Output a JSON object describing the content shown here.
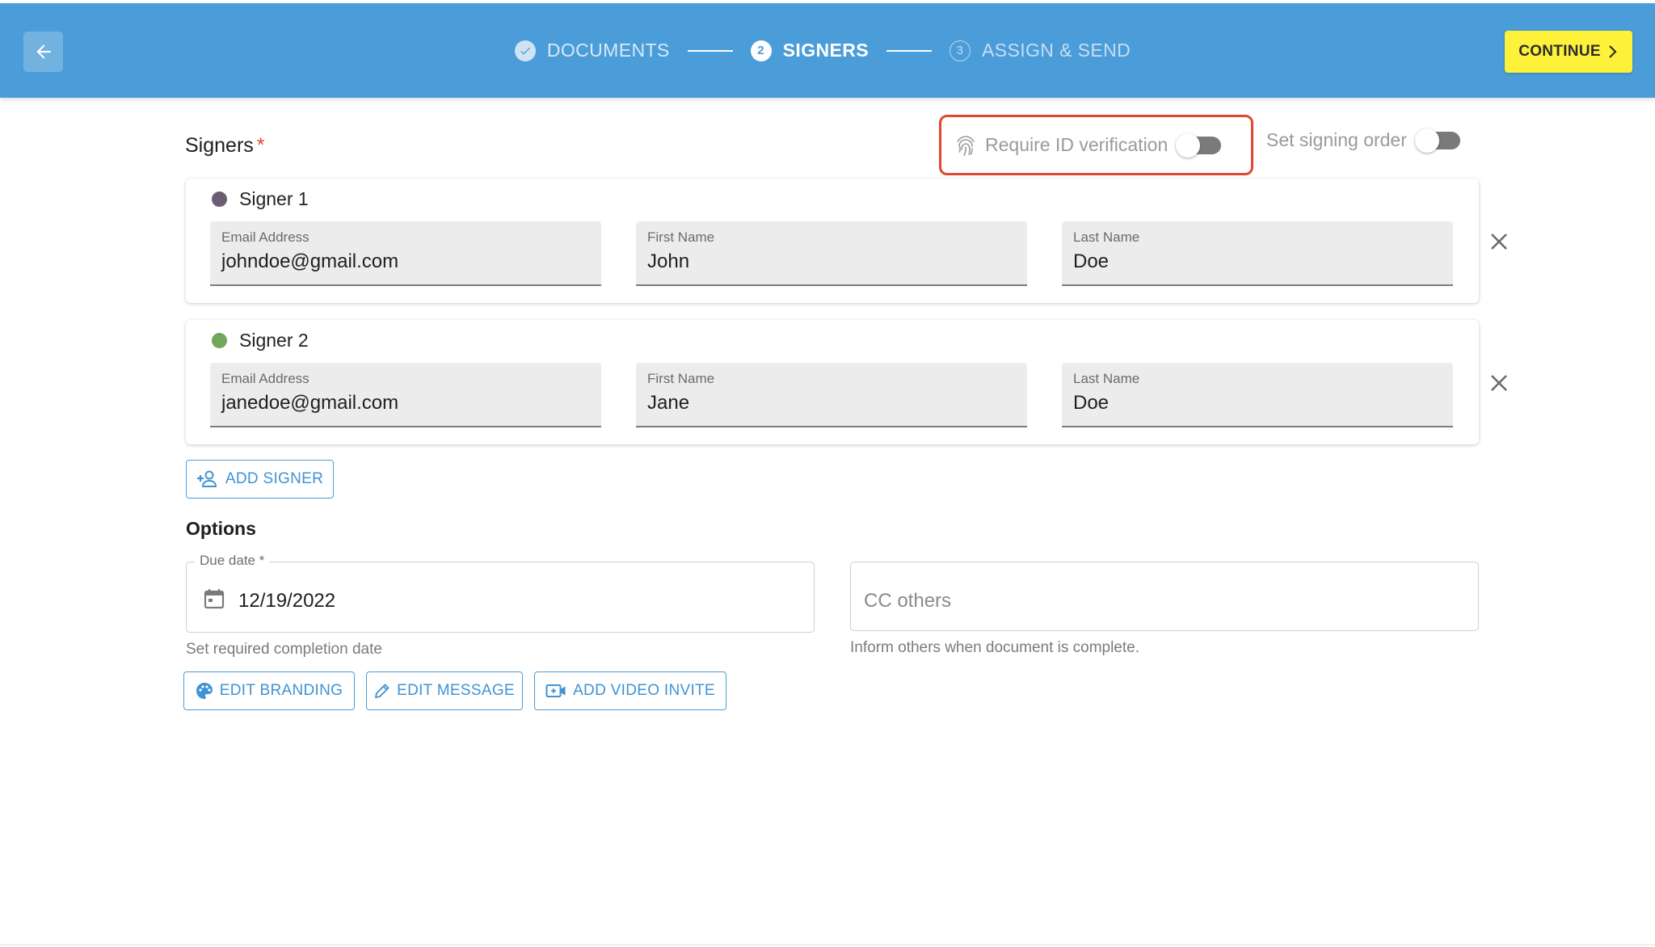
{
  "header": {
    "steps": [
      {
        "label": "DOCUMENTS",
        "badge": "",
        "state": "done"
      },
      {
        "label": "SIGNERS",
        "badge": "2",
        "state": "active"
      },
      {
        "label": "ASSIGN & SEND",
        "badge": "3",
        "state": "pending"
      }
    ],
    "continue_label": "CONTINUE"
  },
  "signers_section": {
    "title": "Signers",
    "required_mark": "*",
    "id_verification_label": "Require ID verification",
    "id_verification_on": false,
    "signing_order_label": "Set signing order",
    "signing_order_on": false
  },
  "signers": [
    {
      "name": "Signer 1",
      "color": "#6b5d72",
      "email_label": "Email Address",
      "email": "johndoe@gmail.com",
      "first_label": "First Name",
      "first": "John",
      "last_label": "Last Name",
      "last": "Doe"
    },
    {
      "name": "Signer 2",
      "color": "#72a659",
      "email_label": "Email Address",
      "email": "janedoe@gmail.com",
      "first_label": "First Name",
      "first": "Jane",
      "last_label": "Last Name",
      "last": "Doe"
    }
  ],
  "add_signer_label": "ADD SIGNER",
  "options": {
    "title": "Options",
    "due_date_label": "Due date *",
    "due_date_value": "12/19/2022",
    "due_date_help": "Set required completion date",
    "cc_placeholder": "CC others",
    "cc_help": "Inform others when document is complete."
  },
  "actions": {
    "edit_branding": "EDIT BRANDING",
    "edit_message": "EDIT MESSAGE",
    "add_video_invite": "ADD VIDEO INVITE"
  },
  "colors": {
    "header": "#4a9dd9",
    "continue": "#fef13a",
    "highlight": "#e1472d",
    "accent": "#3f93d3"
  }
}
